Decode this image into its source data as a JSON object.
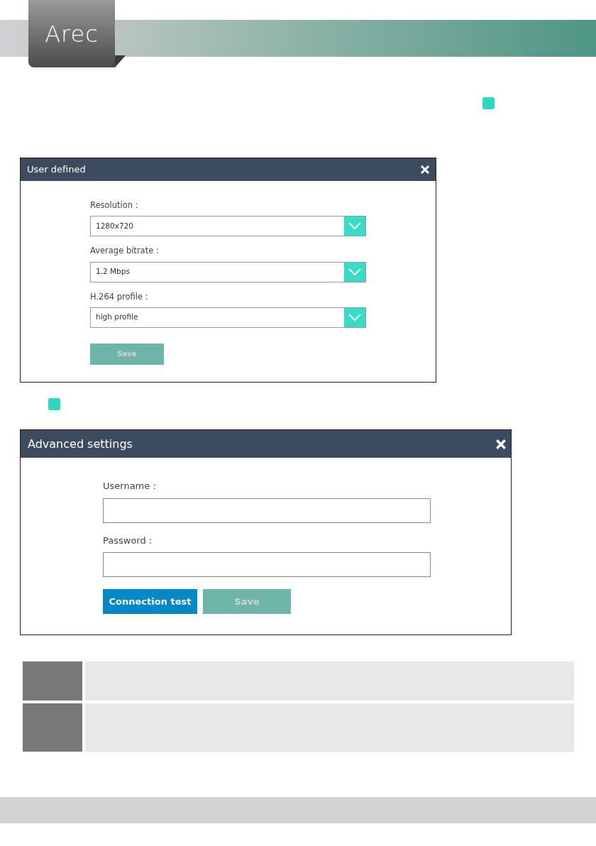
{
  "header": {
    "logo": "Arec"
  },
  "dialogs": [
    {
      "title": "User defined",
      "kind": "dropdowns",
      "fields": [
        {
          "label": "Resolution :",
          "value": "1280x720"
        },
        {
          "label": "Average bitrate :",
          "value": "1.2 Mbps"
        },
        {
          "label": "H.264 profile :",
          "value": "high profile"
        }
      ],
      "buttons": [
        {
          "label": "Save",
          "kind": "save",
          "disabled": true
        }
      ]
    },
    {
      "title": "Advanced settings",
      "kind": "inputs",
      "fields": [
        {
          "label": "Username :"
        },
        {
          "label": "Password :"
        }
      ],
      "buttons": [
        {
          "label": "Connection test",
          "kind": "primary",
          "disabled": false
        },
        {
          "label": "Save",
          "kind": "save",
          "disabled": true
        }
      ]
    }
  ]
}
